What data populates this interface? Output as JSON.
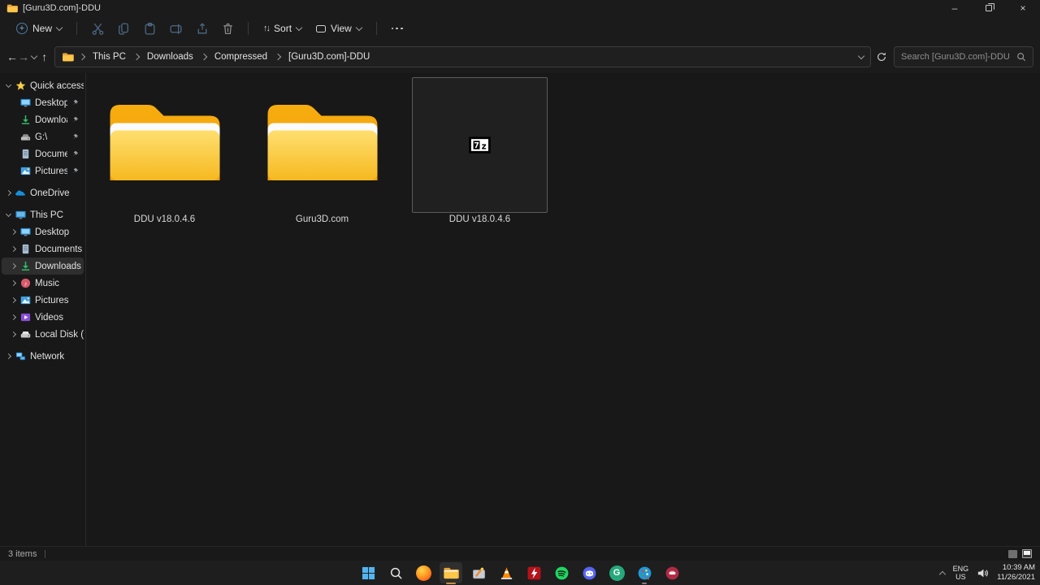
{
  "window": {
    "title": "[Guru3D.com]-DDU"
  },
  "toolbar": {
    "new_label": "New",
    "sort_label": "Sort",
    "view_label": "View"
  },
  "breadcrumb": {
    "items": [
      "This PC",
      "Downloads",
      "Compressed",
      "[Guru3D.com]-DDU"
    ]
  },
  "search": {
    "placeholder": "Search [Guru3D.com]-DDU"
  },
  "sidebar": {
    "rows": [
      {
        "label": "Quick access"
      },
      {
        "label": "Desktop",
        "pinned": true
      },
      {
        "label": "Downloads",
        "pinned": true
      },
      {
        "label": "G:\\",
        "pinned": true
      },
      {
        "label": "Documents",
        "pinned": true
      },
      {
        "label": "Pictures",
        "pinned": true
      },
      {
        "label": "OneDrive"
      },
      {
        "label": "This PC"
      },
      {
        "label": "Desktop"
      },
      {
        "label": "Documents"
      },
      {
        "label": "Downloads",
        "selected": true
      },
      {
        "label": "Music"
      },
      {
        "label": "Pictures"
      },
      {
        "label": "Videos"
      },
      {
        "label": "Local Disk (C:)"
      },
      {
        "label": "Network"
      }
    ]
  },
  "files": {
    "items": [
      {
        "name": "DDU v18.0.4.6",
        "type": "folder"
      },
      {
        "name": "Guru3D.com",
        "type": "folder"
      },
      {
        "name": "DDU v18.0.4.6",
        "type": "7z-archive",
        "selected": true
      }
    ]
  },
  "statusbar": {
    "count": "3 items"
  },
  "taskbar": {
    "icons": [
      "start",
      "search",
      "firefox",
      "file-explorer",
      "ccleaner",
      "vlc",
      "msi-afterburner",
      "spotify",
      "discord",
      "grammarly",
      "paint-palette",
      "media-app"
    ]
  },
  "tray": {
    "lang1": "ENG",
    "lang2": "US",
    "time": "10:39 AM",
    "date": "11/26/2021"
  },
  "colors": {
    "folder_front": "#f8bd26",
    "folder_back": "#f3a011",
    "selection_border": "#5c5c5c",
    "active_underline": "#c98e3f",
    "chrome_bg": "#1b1b1b",
    "content_bg": "#181818"
  }
}
